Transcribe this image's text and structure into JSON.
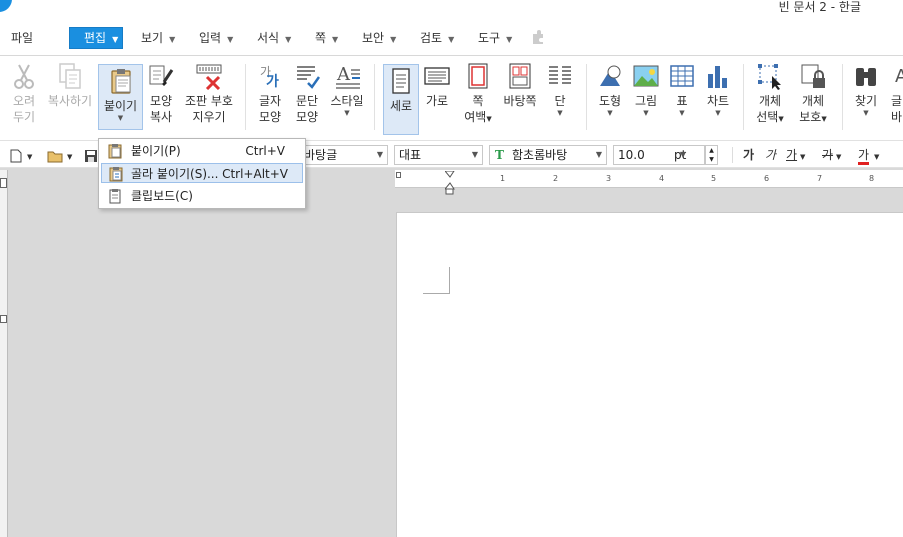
{
  "window": {
    "title": "빈 문서 2 - 한글"
  },
  "menubar": {
    "items": [
      {
        "label": "파일"
      },
      {
        "label": "편집"
      },
      {
        "label": "보기"
      },
      {
        "label": "입력"
      },
      {
        "label": "서식"
      },
      {
        "label": "쪽"
      },
      {
        "label": "보안"
      },
      {
        "label": "검토"
      },
      {
        "label": "도구"
      }
    ]
  },
  "ribbon": {
    "cut": {
      "line1": "오려",
      "line2": "두기"
    },
    "copy": {
      "line1": "복사하기"
    },
    "paste": {
      "line1": "붙이기"
    },
    "format_copy": {
      "line1": "모양",
      "line2": "복사"
    },
    "erase_marks": {
      "line1": "조판 부호",
      "line2": "지우기"
    },
    "char_shape": {
      "line1": "글자",
      "line2": "모양"
    },
    "para_shape": {
      "line1": "문단",
      "line2": "모양"
    },
    "style": {
      "line1": "스타일"
    },
    "portrait": {
      "line1": "세로"
    },
    "landscape": {
      "line1": "가로"
    },
    "margins": {
      "line1": "쪽",
      "line2": "여백"
    },
    "background": {
      "line1": "바탕쪽"
    },
    "columns": {
      "line1": "단"
    },
    "shapes": {
      "line1": "도형"
    },
    "picture": {
      "line1": "그림"
    },
    "table": {
      "line1": "표"
    },
    "chart": {
      "line1": "차트"
    },
    "obj_select": {
      "line1": "개체",
      "line2": "선택"
    },
    "obj_protect": {
      "line1": "개체",
      "line2": "보호"
    },
    "find": {
      "line1": "찾기"
    },
    "partial": {
      "line1": "글",
      "line2": "바"
    }
  },
  "formatbar": {
    "font_lang": "바탕글",
    "style": "대표",
    "font_name": "함초롬바탕",
    "font_size": "10.0",
    "size_unit": "pt",
    "bold": "가",
    "italic": "가",
    "underline": "가",
    "strike": "가",
    "color": "가"
  },
  "ruler": {
    "numbers": [
      "1",
      "2",
      "3",
      "4",
      "5",
      "6",
      "7",
      "8"
    ]
  },
  "paste_menu": {
    "items": [
      {
        "label": "붙이기(P)",
        "shortcut": "Ctrl+V"
      },
      {
        "label": "골라 붙이기(S)...",
        "shortcut": "Ctrl+Alt+V"
      },
      {
        "label": "클립보드(C)",
        "shortcut": ""
      }
    ]
  },
  "colors": {
    "accent": "#1a8fe0",
    "highlight": "#dde9f7"
  }
}
